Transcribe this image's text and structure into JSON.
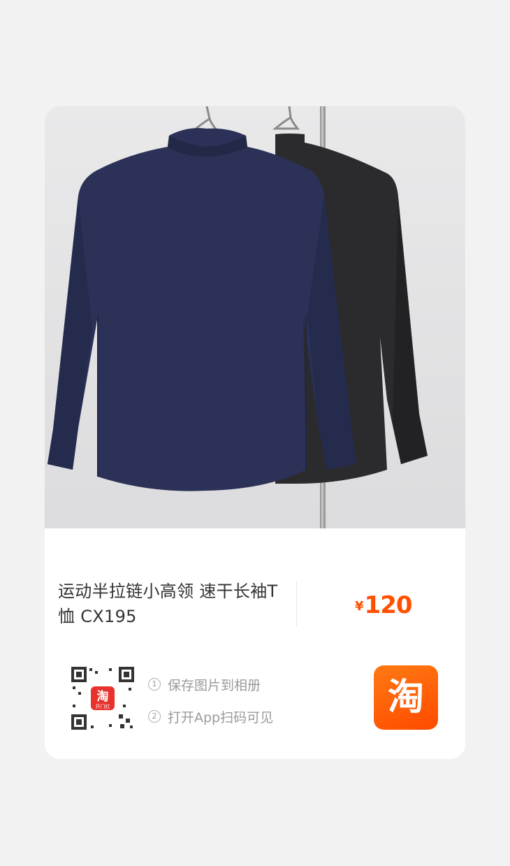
{
  "product": {
    "title": "运动半拉链小高领 速干长袖T恤 CX195",
    "price_symbol": "¥",
    "price_value": "120"
  },
  "share": {
    "step1_num": "①",
    "step1_text": "保存图片到相册",
    "step2_num": "②",
    "step2_text": "打开App扫码可见",
    "qr_logo_text": "淘",
    "qr_logo_sub": "开门红"
  },
  "app_button": {
    "label": "淘"
  },
  "colors": {
    "accent": "#ff5000",
    "navy_shirt": "#2a3158",
    "black_shirt": "#2a2a2c",
    "background": "#f2f2f2"
  },
  "icons": [
    "product-photo",
    "qr-code",
    "taobao-app-icon"
  ]
}
